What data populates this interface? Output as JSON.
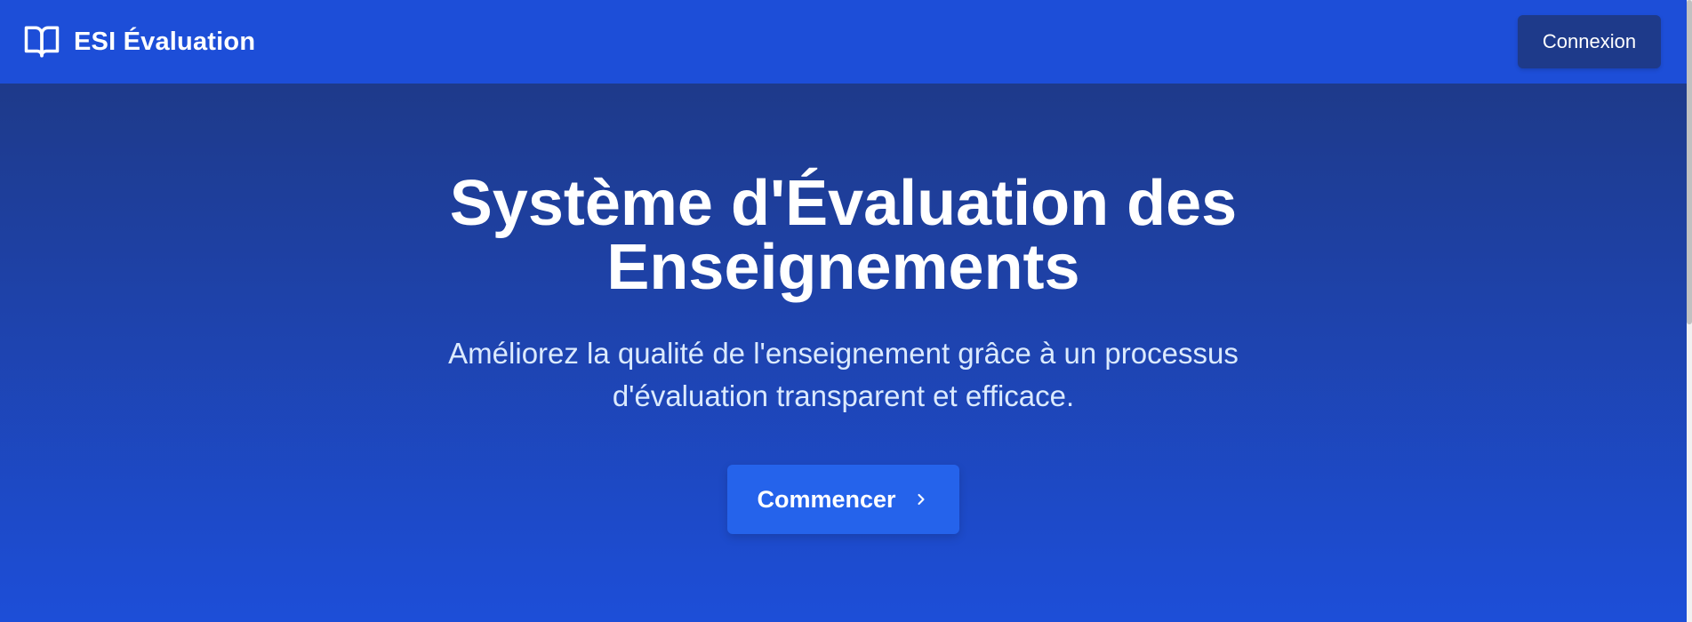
{
  "header": {
    "brand_name": "ESI Évaluation",
    "brand_icon": "book-open-icon",
    "login_label": "Connexion"
  },
  "hero": {
    "title_line1": "Système d'Évaluation des",
    "title_line2": "Enseignements",
    "subtitle_line1": "Améliorez la qualité de l'enseignement grâce à un processus",
    "subtitle_line2": "d'évaluation transparent et efficace.",
    "cta_label": "Commencer",
    "cta_icon": "chevron-right-icon"
  },
  "colors": {
    "navbar": "#1d4ed8",
    "hero_top": "#1e3a8a",
    "hero_bottom": "#1d4ed8",
    "login_button": "#1e3a8a",
    "cta_button": "#2563eb"
  }
}
